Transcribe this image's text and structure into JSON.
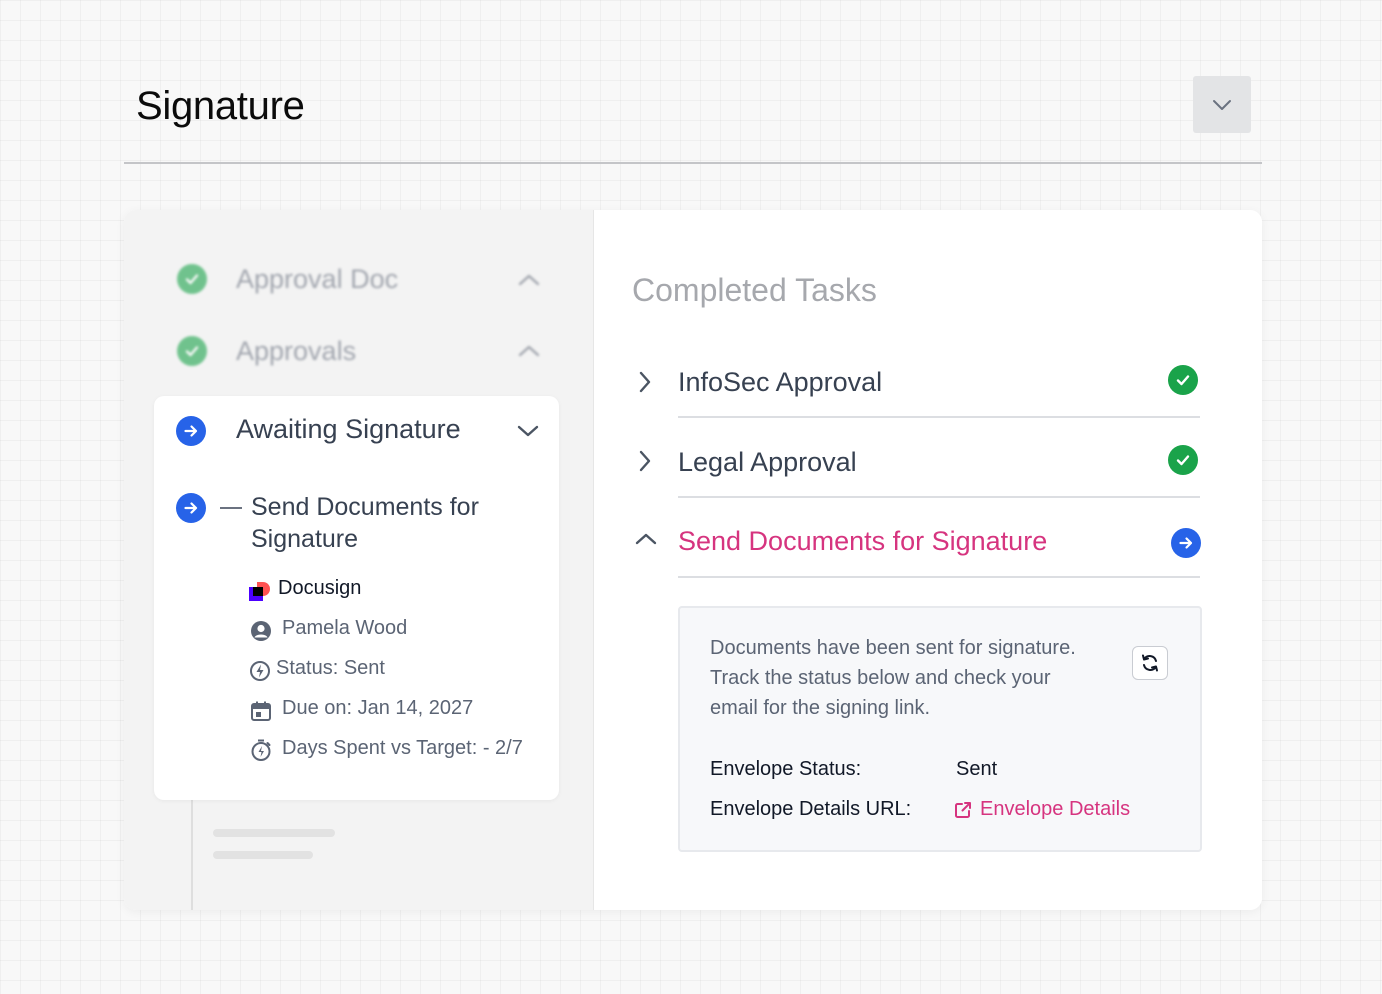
{
  "header": {
    "title": "Signature"
  },
  "steps": [
    {
      "label": "Approval Doc",
      "status": "complete"
    },
    {
      "label": "Approvals",
      "status": "complete"
    },
    {
      "label": "Awaiting Signature",
      "status": "active"
    }
  ],
  "active_step": {
    "sub_task": {
      "line1": "Send Documents for",
      "line2": "Signature"
    },
    "provider": "Docusign",
    "assignee": "Pamela Wood",
    "status": "Status: Sent",
    "due": "Due on: Jan 14, 2027",
    "days": "Days Spent vs Target: - 2/7"
  },
  "completed": {
    "title": "Completed Tasks",
    "tasks": [
      {
        "label": "InfoSec Approval",
        "state": "done"
      },
      {
        "label": "Legal Approval",
        "state": "done"
      },
      {
        "label": "Send Documents for Signature",
        "state": "active"
      }
    ],
    "detail": {
      "message": [
        "Documents have been sent for signature.",
        "Track the status below and check your",
        "email for the signing link."
      ],
      "envelope_status_label": "Envelope Status:",
      "envelope_status_value": "Sent",
      "envelope_url_label": "Envelope Details URL:",
      "envelope_url_link": "Envelope Details"
    }
  },
  "colors": {
    "accent": "#d6347f",
    "primary": "#2763e8",
    "success": "#1aa34a"
  }
}
